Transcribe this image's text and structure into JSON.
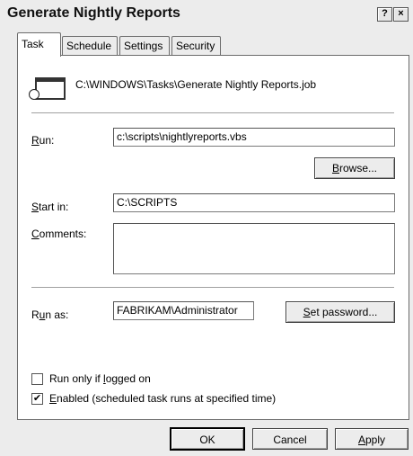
{
  "window": {
    "title": "Generate Nightly Reports",
    "help_button": "?",
    "close_button": "×"
  },
  "tabs": [
    {
      "label": "Task",
      "active": true
    },
    {
      "label": "Schedule",
      "active": false
    },
    {
      "label": "Settings",
      "active": false
    },
    {
      "label": "Security",
      "active": false
    }
  ],
  "task": {
    "path": "C:\\WINDOWS\\Tasks\\Generate Nightly Reports.job",
    "icon": "scheduled-task-icon",
    "run": {
      "label_pre": "",
      "label_key": "R",
      "label_post": "un:",
      "value": "c:\\scripts\\nightlyreports.vbs"
    },
    "browse_button": {
      "pre": "",
      "key": "B",
      "post": "rowse..."
    },
    "start_in": {
      "label_pre": "",
      "label_key": "S",
      "label_post": "tart in:",
      "value": "C:\\SCRIPTS"
    },
    "comments": {
      "label_pre": "",
      "label_key": "C",
      "label_post": "omments:",
      "value": ""
    },
    "run_as": {
      "label_pre": "R",
      "label_key": "u",
      "label_post": "n as:",
      "value": "FABRIKAM\\Administrator"
    },
    "set_password_button": {
      "pre": "",
      "key": "S",
      "post": "et password..."
    },
    "run_only_logged_on": {
      "label_pre": "Run only if ",
      "label_key": "l",
      "label_post": "ogged on",
      "checked": false
    },
    "enabled": {
      "label_pre": "",
      "label_key": "E",
      "label_post": "nabled (scheduled task runs at specified time)",
      "checked": true,
      "mark": "✔"
    }
  },
  "footer": {
    "ok_label": "OK",
    "cancel_label": "Cancel",
    "apply": {
      "pre": "",
      "key": "A",
      "post": "pply"
    }
  }
}
